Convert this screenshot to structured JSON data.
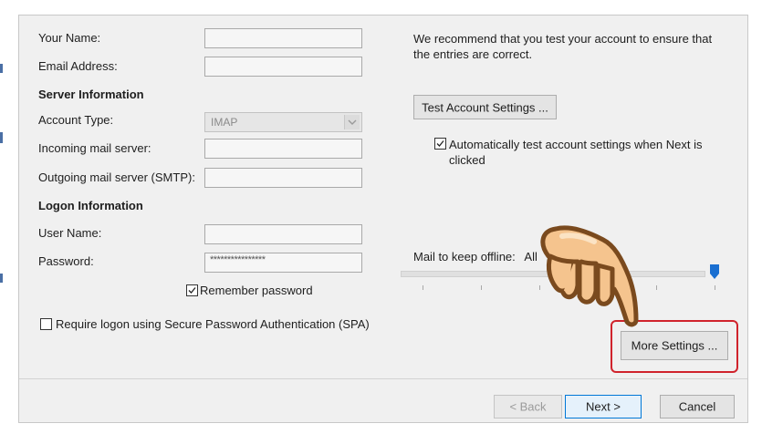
{
  "labels": {
    "your_name": "Your Name:",
    "email_address": "Email Address:",
    "server_information": "Server Information",
    "account_type": "Account Type:",
    "incoming_mail_server": "Incoming mail server:",
    "outgoing_mail_server": "Outgoing mail server (SMTP):",
    "logon_information": "Logon Information",
    "user_name": "User Name:",
    "password": "Password:"
  },
  "fields": {
    "account_type_value": "IMAP",
    "password_value": "****************"
  },
  "checkboxes": {
    "remember_password": "Remember password",
    "require_spa": "Require logon using Secure Password Authentication (SPA)",
    "auto_test": "Automatically test account settings when Next is clicked"
  },
  "right_panel": {
    "recommend_text": "We recommend that you test your account to ensure that the entries are correct.",
    "test_button": "Test Account Settings ...",
    "offline_label": "Mail to keep offline:",
    "offline_value": "All",
    "offline_slider_level": 1.0
  },
  "buttons": {
    "more_settings": "More Settings ...",
    "back": "< Back",
    "next": "Next >",
    "cancel": "Cancel"
  },
  "colors": {
    "highlight": "#d0232c",
    "slider_thumb": "#1a6fd1",
    "primary_border": "#0078d7"
  },
  "icons": {
    "pointer": "pointing-hand-icon",
    "dropdown": "chevron-down-icon",
    "check": "checkmark-icon"
  }
}
